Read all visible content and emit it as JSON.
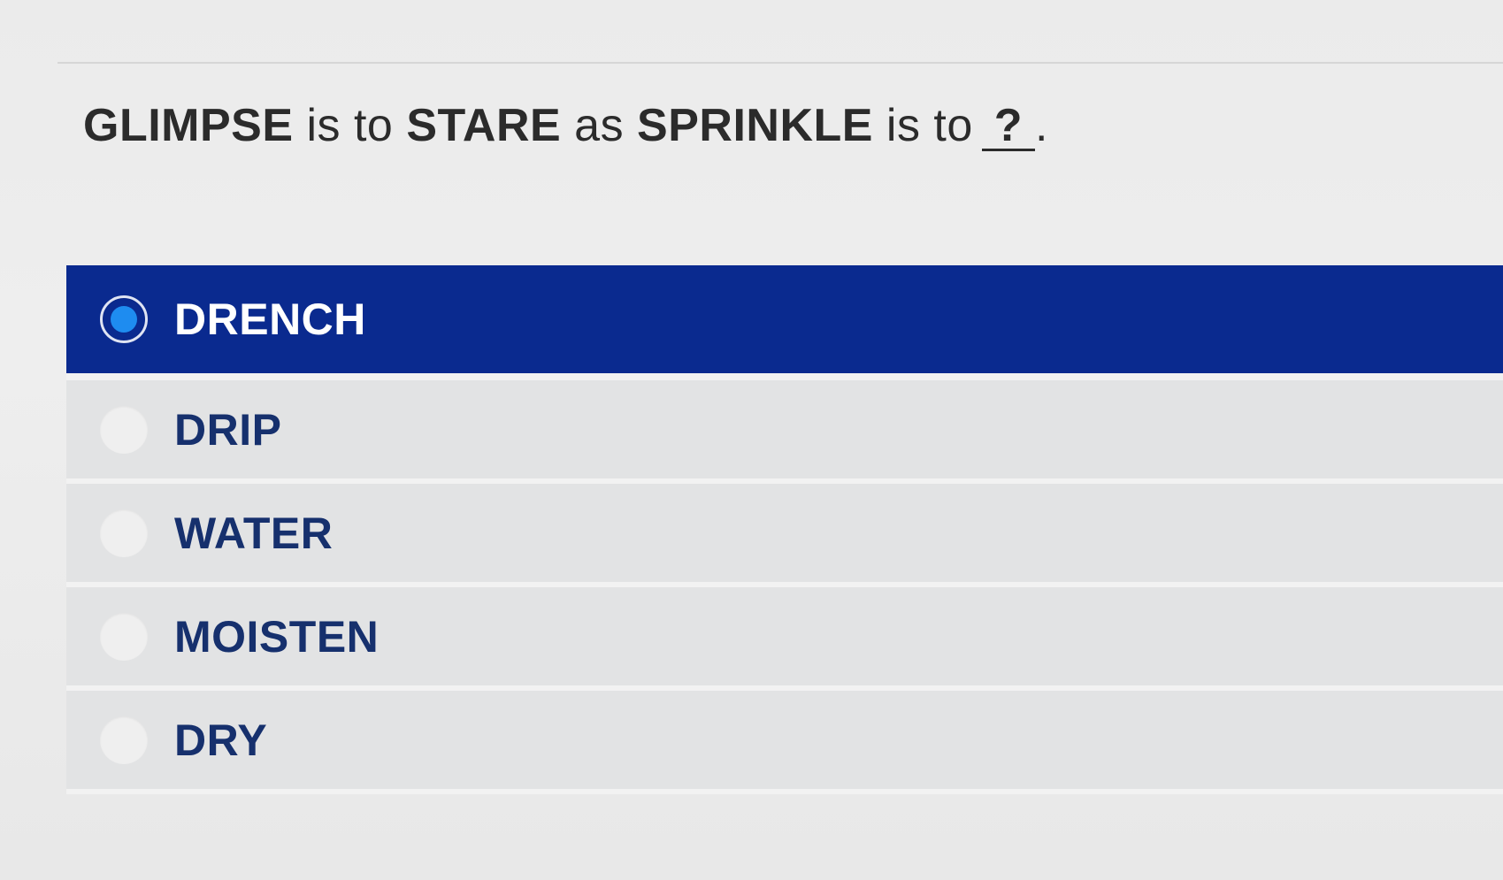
{
  "question": {
    "term_a": "GLIMPSE",
    "conn_1": "is to",
    "term_b": "STARE",
    "conn_2": "as",
    "term_c": "SPRINKLE",
    "conn_3": "is to",
    "blank": "?",
    "period": "."
  },
  "options": [
    {
      "label": "DRENCH",
      "selected": true
    },
    {
      "label": "DRIP",
      "selected": false
    },
    {
      "label": "WATER",
      "selected": false
    },
    {
      "label": "MOISTEN",
      "selected": false
    },
    {
      "label": "DRY",
      "selected": false
    }
  ],
  "colors": {
    "selected_bg": "#0a2a8f",
    "radio_dot": "#1e8cf0",
    "option_bg": "#e2e3e4",
    "option_text": "#16306d"
  }
}
